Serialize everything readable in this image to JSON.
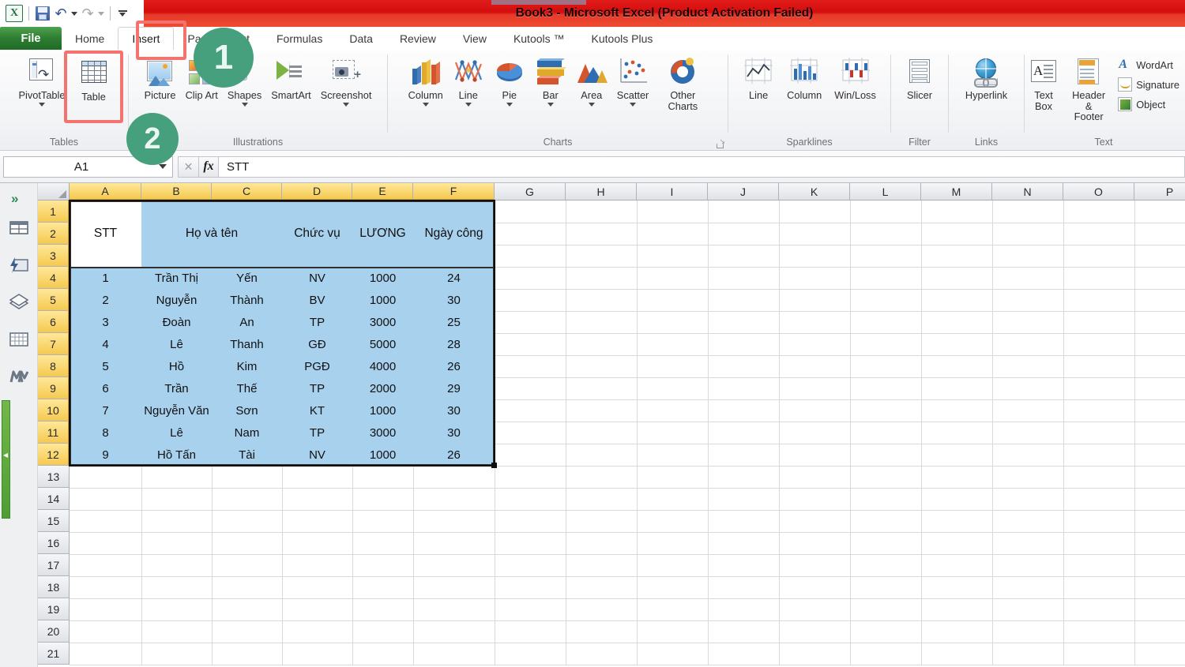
{
  "window": {
    "title": "Book3  -  Microsoft Excel (Product Activation Failed)"
  },
  "quick_access": {
    "logo": "X",
    "items": [
      {
        "name": "save-icon",
        "label": "Save"
      },
      {
        "name": "undo-icon",
        "label": "Undo"
      },
      {
        "name": "redo-icon",
        "label": "Redo"
      },
      {
        "name": "customize-qat-icon",
        "label": "Customize Quick Access Toolbar"
      }
    ]
  },
  "tabs": {
    "file": "File",
    "items": [
      {
        "label": "Home",
        "active": false
      },
      {
        "label": "Insert",
        "active": true
      },
      {
        "label": "Page Layout",
        "active": false
      },
      {
        "label": "Formulas",
        "active": false
      },
      {
        "label": "Data",
        "active": false
      },
      {
        "label": "Review",
        "active": false
      },
      {
        "label": "View",
        "active": false
      },
      {
        "label": "Kutools ™",
        "active": false
      },
      {
        "label": "Kutools Plus",
        "active": false
      }
    ]
  },
  "ribbon": {
    "groups": [
      {
        "name": "Tables",
        "label": "Tables",
        "buttons": [
          {
            "label": "PivotTable",
            "icon": "pivottable-icon",
            "dropdown": true
          },
          {
            "label": "Table",
            "icon": "table-icon",
            "dropdown": false,
            "highlighted": true
          }
        ]
      },
      {
        "name": "Illustrations",
        "label": "Illustrations",
        "buttons": [
          {
            "label": "Picture",
            "icon": "picture-icon",
            "dropdown": false
          },
          {
            "label": "Clip Art",
            "icon": "clipart-icon",
            "dropdown": false
          },
          {
            "label": "Shapes",
            "icon": "shapes-icon",
            "dropdown": true
          },
          {
            "label": "SmartArt",
            "icon": "smartart-icon",
            "dropdown": false
          },
          {
            "label": "Screenshot",
            "icon": "screenshot-icon",
            "dropdown": true
          }
        ]
      },
      {
        "name": "Charts",
        "label": "Charts",
        "buttons": [
          {
            "label": "Column",
            "icon": "column-chart-icon",
            "dropdown": true
          },
          {
            "label": "Line",
            "icon": "line-chart-icon",
            "dropdown": true
          },
          {
            "label": "Pie",
            "icon": "pie-chart-icon",
            "dropdown": true
          },
          {
            "label": "Bar",
            "icon": "bar-chart-icon",
            "dropdown": true
          },
          {
            "label": "Area",
            "icon": "area-chart-icon",
            "dropdown": true
          },
          {
            "label": "Scatter",
            "icon": "scatter-chart-icon",
            "dropdown": true
          },
          {
            "label": "Other Charts",
            "icon": "other-charts-icon",
            "dropdown": true
          }
        ],
        "dialog_launcher": true
      },
      {
        "name": "Sparklines",
        "label": "Sparklines",
        "buttons": [
          {
            "label": "Line",
            "icon": "sparkline-line-icon",
            "dropdown": false
          },
          {
            "label": "Column",
            "icon": "sparkline-column-icon",
            "dropdown": false
          },
          {
            "label": "Win/Loss",
            "icon": "sparkline-winloss-icon",
            "dropdown": false
          }
        ]
      },
      {
        "name": "Filter",
        "label": "Filter",
        "buttons": [
          {
            "label": "Slicer",
            "icon": "slicer-icon",
            "dropdown": false
          }
        ]
      },
      {
        "name": "Links",
        "label": "Links",
        "buttons": [
          {
            "label": "Hyperlink",
            "icon": "hyperlink-icon",
            "dropdown": false
          }
        ]
      },
      {
        "name": "Text",
        "label": "Text",
        "buttons": [
          {
            "label": "Text Box",
            "icon": "textbox-icon",
            "dropdown": false
          },
          {
            "label": "Header & Footer",
            "icon": "header-footer-icon",
            "dropdown": false
          }
        ],
        "small_buttons": [
          {
            "label": "WordArt",
            "icon": "wordart-icon"
          },
          {
            "label": "Signature",
            "icon": "signature-line-icon"
          },
          {
            "label": "Object",
            "icon": "object-icon"
          }
        ]
      }
    ]
  },
  "formula_bar": {
    "name_box": "A1",
    "cancel_label": "✕",
    "enter_label": "✓",
    "fx_label": "fx",
    "value": "STT"
  },
  "sidebar": {
    "toggle": "»",
    "icons": [
      "navigation-pane-icon",
      "quick-tools-icon",
      "worksheet-stack-icon",
      "range-grid-icon",
      "find-replace-icon"
    ]
  },
  "sheet": {
    "columns": [
      "A",
      "B",
      "C",
      "D",
      "E",
      "F",
      "G",
      "H",
      "I",
      "J",
      "K",
      "L",
      "M",
      "N",
      "O",
      "P"
    ],
    "selected_columns": [
      "A",
      "B",
      "C",
      "D",
      "E",
      "F"
    ],
    "rows": [
      1,
      2,
      3,
      4,
      5,
      6,
      7,
      8,
      9,
      10,
      11,
      12,
      13,
      14,
      15,
      16,
      17,
      18,
      19,
      20,
      21
    ],
    "selected_rows": [
      1,
      2,
      3,
      4,
      5,
      6,
      7,
      8,
      9,
      10,
      11,
      12
    ],
    "headers": {
      "stt": "STT",
      "name": "Họ và tên",
      "position": "Chức vụ",
      "salary": "LƯƠNG",
      "workdays": "Ngày công"
    },
    "data": [
      {
        "stt": "1",
        "last": "Trần Thị",
        "first": "Yến",
        "position": "NV",
        "salary": "1000",
        "workdays": "24"
      },
      {
        "stt": "2",
        "last": "Nguyễn",
        "first": "Thành",
        "position": "BV",
        "salary": "1000",
        "workdays": "30"
      },
      {
        "stt": "3",
        "last": "Đoàn",
        "first": "An",
        "position": "TP",
        "salary": "3000",
        "workdays": "25"
      },
      {
        "stt": "4",
        "last": "Lê",
        "first": "Thanh",
        "position": "GĐ",
        "salary": "5000",
        "workdays": "28"
      },
      {
        "stt": "5",
        "last": "Hồ",
        "first": "Kim",
        "position": "PGĐ",
        "salary": "4000",
        "workdays": "26"
      },
      {
        "stt": "6",
        "last": "Trần",
        "first": "Thế",
        "position": "TP",
        "salary": "2000",
        "workdays": "29"
      },
      {
        "stt": "7",
        "last": "Nguyễn Văn",
        "first": "Sơn",
        "position": "KT",
        "salary": "1000",
        "workdays": "30"
      },
      {
        "stt": "8",
        "last": "Lê",
        "first": "Nam",
        "position": "TP",
        "salary": "3000",
        "workdays": "30"
      },
      {
        "stt": "9",
        "last": "Hồ Tấn",
        "first": "Tài",
        "position": "NV",
        "salary": "1000",
        "workdays": "26"
      }
    ]
  },
  "annotations": {
    "step1": "1",
    "step2": "2",
    "highlight_color": "#f4736f",
    "badge_color": "#46a07e"
  }
}
